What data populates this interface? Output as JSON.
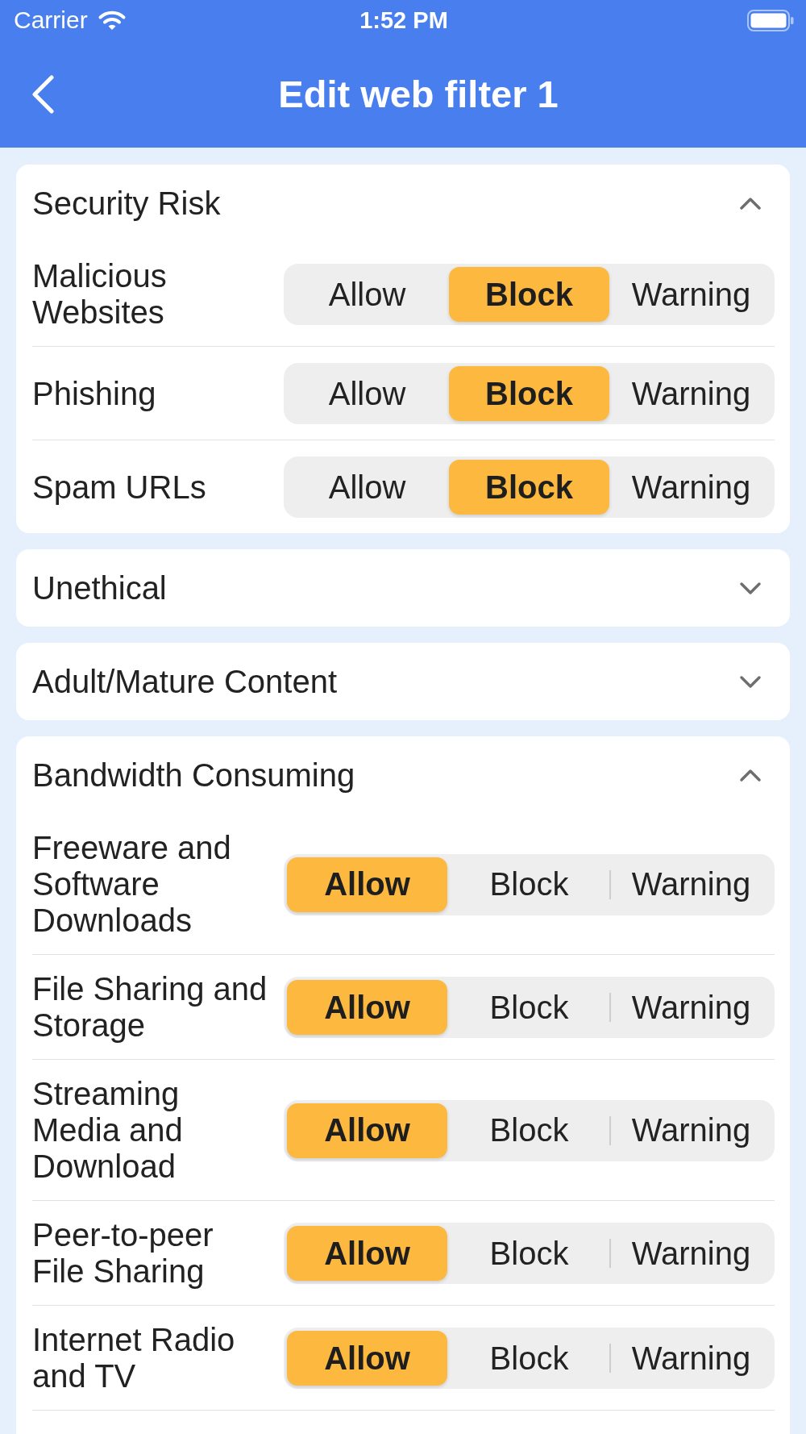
{
  "status_bar": {
    "carrier": "Carrier",
    "time": "1:52 PM"
  },
  "header": {
    "title": "Edit web filter 1"
  },
  "categories": [
    {
      "title": "Security Risk",
      "expanded": true,
      "items": [
        {
          "name": "Malicious Websites",
          "options": [
            {
              "label": "Allow",
              "selected": false
            },
            {
              "label": "Block",
              "selected": true
            },
            {
              "label": "Warning",
              "selected": false
            }
          ]
        },
        {
          "name": "Phishing",
          "options": [
            {
              "label": "Allow",
              "selected": false
            },
            {
              "label": "Block",
              "selected": true
            },
            {
              "label": "Warning",
              "selected": false
            }
          ]
        },
        {
          "name": "Spam URLs",
          "options": [
            {
              "label": "Allow",
              "selected": false
            },
            {
              "label": "Block",
              "selected": true
            },
            {
              "label": "Warning",
              "selected": false
            }
          ]
        }
      ]
    },
    {
      "title": "Unethical",
      "expanded": false
    },
    {
      "title": "Adult/Mature Content",
      "expanded": false
    },
    {
      "title": "Bandwidth Consuming",
      "expanded": true,
      "items": [
        {
          "name": "Freeware and Software Downloads",
          "options": [
            {
              "label": "Allow",
              "selected": true
            },
            {
              "label": "Block",
              "selected": false
            },
            {
              "label": "Warning",
              "selected": false
            }
          ]
        },
        {
          "name": "File Sharing and Storage",
          "options": [
            {
              "label": "Allow",
              "selected": true
            },
            {
              "label": "Block",
              "selected": false
            },
            {
              "label": "Warning",
              "selected": false
            }
          ]
        },
        {
          "name": "Streaming Media and Download",
          "options": [
            {
              "label": "Allow",
              "selected": true
            },
            {
              "label": "Block",
              "selected": false
            },
            {
              "label": "Warning",
              "selected": false
            }
          ]
        },
        {
          "name": "Peer-to-peer File Sharing",
          "options": [
            {
              "label": "Allow",
              "selected": true
            },
            {
              "label": "Block",
              "selected": false
            },
            {
              "label": "Warning",
              "selected": false
            }
          ]
        },
        {
          "name": "Internet Radio and TV",
          "options": [
            {
              "label": "Allow",
              "selected": true
            },
            {
              "label": "Block",
              "selected": false
            },
            {
              "label": "Warning",
              "selected": false
            }
          ]
        }
      ]
    }
  ]
}
